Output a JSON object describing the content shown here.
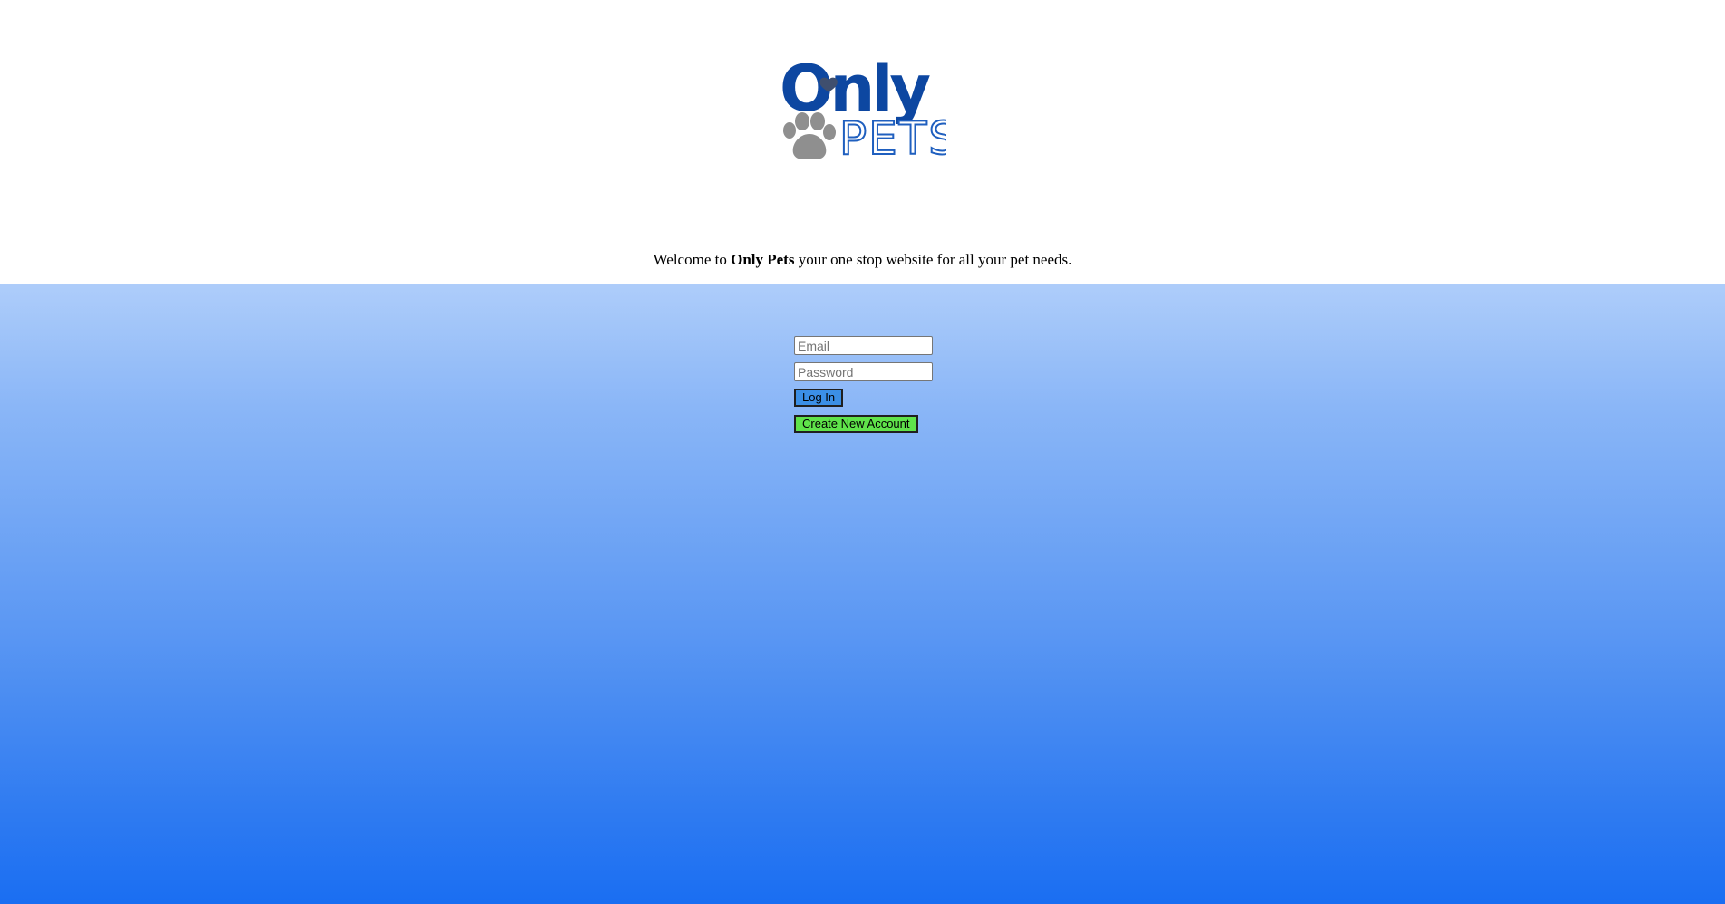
{
  "brand": {
    "logo_word_top": "Only",
    "logo_word_bottom": "PETS",
    "logo_primary_color": "#0d47a1",
    "logo_paw_color": "#8f8f8f"
  },
  "welcome": {
    "prefix": "Welcome to",
    "brand_name": "Only Pets",
    "suffix": "your one stop website for all your pet needs."
  },
  "login": {
    "email_placeholder": "Email",
    "email_value": "",
    "password_placeholder": "Password",
    "password_value": "",
    "login_button_label": "Log In",
    "create_account_button_label": "Create New Account"
  },
  "colors": {
    "background_gradient_top": "#aecdfa",
    "background_gradient_bottom": "#1a6ef2",
    "login_button": "#3b8fe6",
    "create_account_button": "#5fe34a"
  }
}
